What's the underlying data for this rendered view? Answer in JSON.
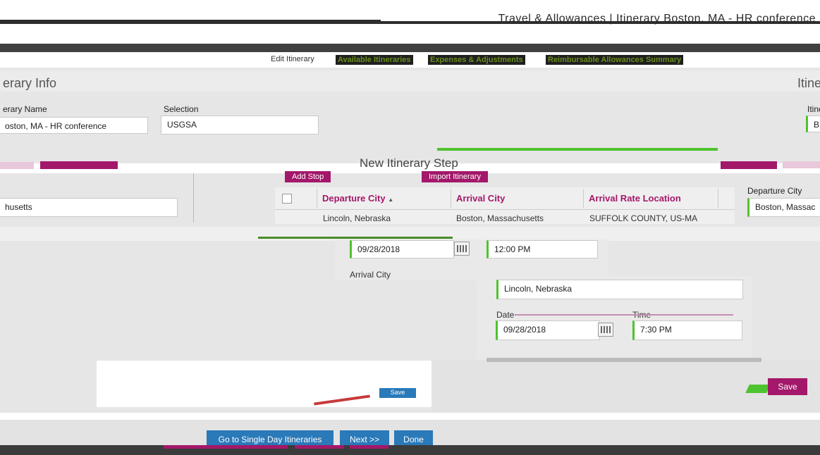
{
  "header": {
    "title": "Travel & Allowances | Itinerary Boston, MA - HR conference"
  },
  "tabs": {
    "edit_itinerary": "Edit Itinerary",
    "available_itineraries": "Available Itineraries",
    "expenses_adjustments": "Expenses & Adjustments",
    "allowances_summary": "Reimbursable Allowances Summary"
  },
  "itinerary_info": {
    "heading": "erary Info",
    "heading_right": "Itine",
    "name_label": "erary Name",
    "name_value": "oston, MA - HR conference",
    "selection_label": "Selection",
    "selection_value": "USGSA",
    "right_label": "Itine",
    "right_value": "B"
  },
  "toolbar": {
    "add_stop": "Add Stop",
    "import_itinerary": "Import Itinerary"
  },
  "new_stop": {
    "title": "New Itinerary Step"
  },
  "left_field": {
    "value": "husetts"
  },
  "grid": {
    "columns": [
      "Departure City",
      "Arrival City",
      "Arrival Rate Location"
    ],
    "sort_indicator": "▲",
    "rows": [
      {
        "departure": "Lincoln, Nebraska",
        "arrival": "Boston, Massachusetts",
        "rate_location": "SUFFOLK COUNTY, US-MA"
      }
    ]
  },
  "right_panel": {
    "departure_city_label": "Departure City",
    "departure_city_value": "Boston, Massac"
  },
  "departure": {
    "date": "09/28/2018",
    "time": "12:00 PM"
  },
  "arrival": {
    "city_label": "Arrival City",
    "city_value": "Lincoln, Nebraska",
    "date_label": "Date",
    "date_value": "09/28/2018",
    "time_label": "Time",
    "time_value": "7:30 PM"
  },
  "buttons": {
    "save": "Save",
    "save_small": "Save",
    "go_single_day": "Go to Single Day Itineraries",
    "next": "Next >>",
    "done": "Done"
  },
  "colors": {
    "accent": "#a3186a",
    "primary_button": "#2a79b8",
    "required_indicator": "#4fc32f"
  }
}
